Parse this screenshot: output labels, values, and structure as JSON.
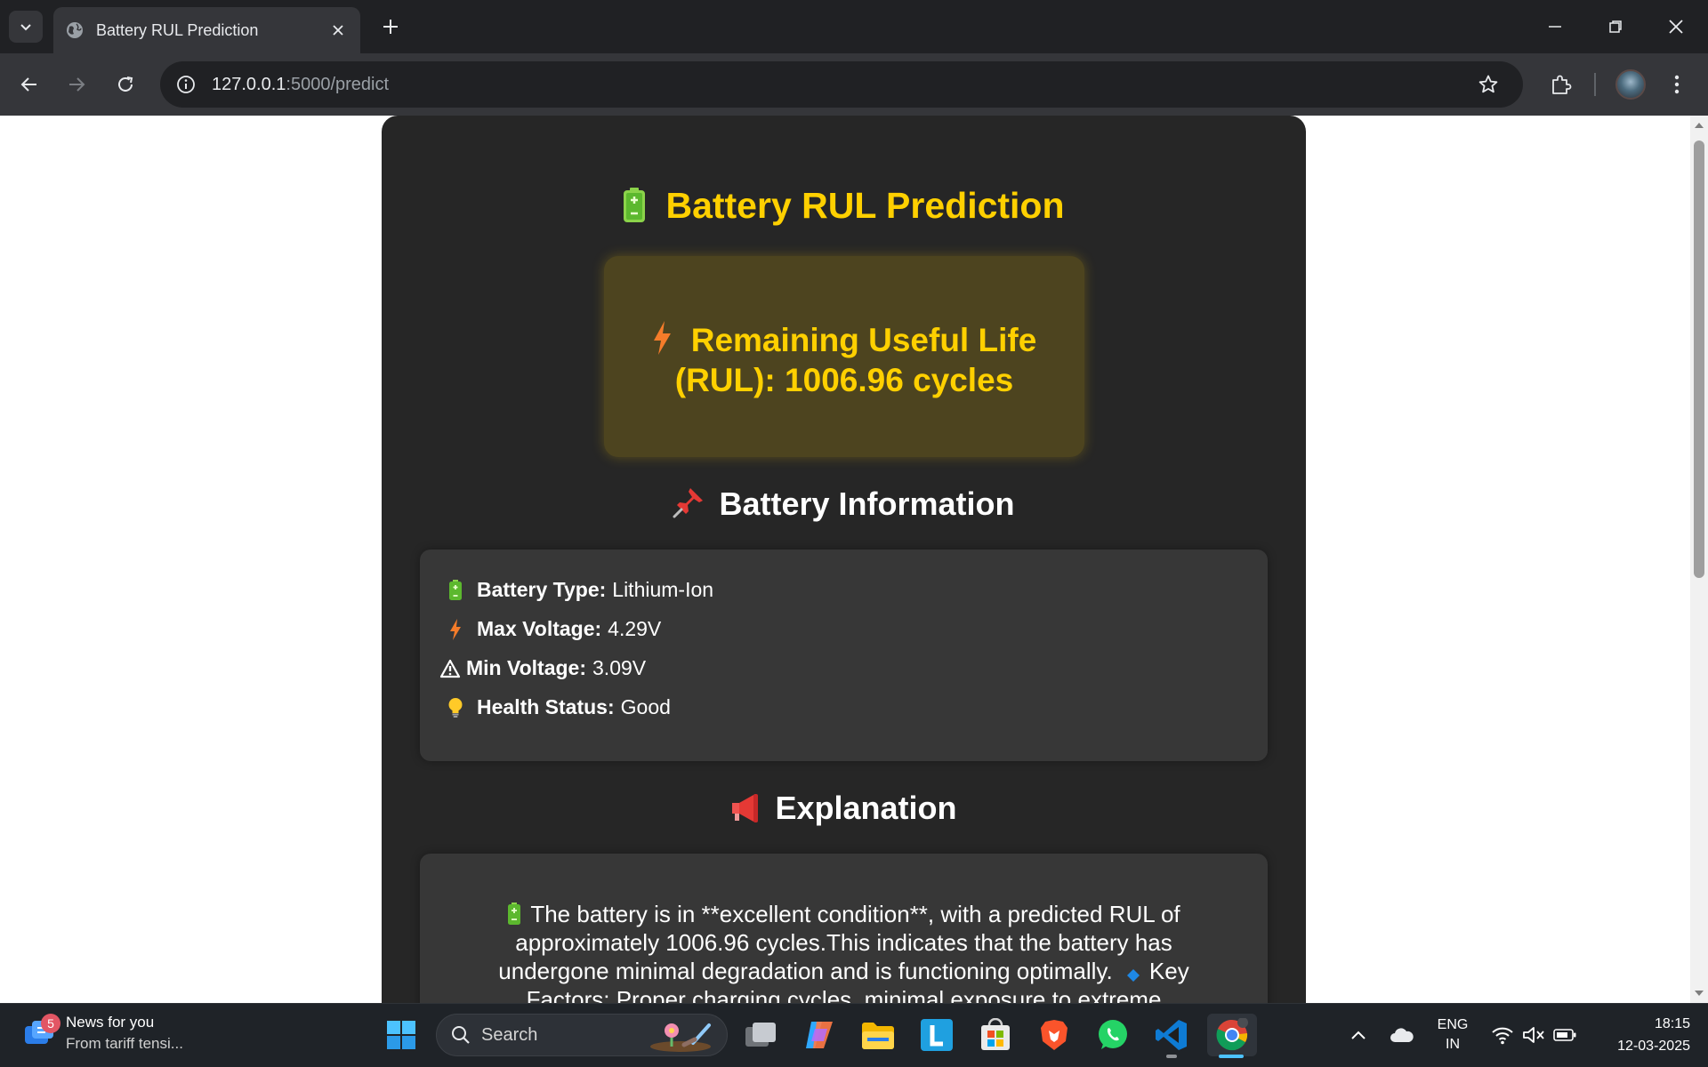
{
  "browser": {
    "tab_title": "Battery RUL Prediction",
    "url_host": "127.0.0.1",
    "url_path": ":5000/predict"
  },
  "page": {
    "title": "Battery RUL Prediction",
    "rul_label": "Remaining Useful Life (RUL):",
    "rul_value": "1006.96 cycles",
    "info_title": "Battery Information",
    "info_items": [
      {
        "icon": "battery-icon",
        "label": "Battery Type:",
        "value": "Lithium-Ion"
      },
      {
        "icon": "lightning-icon",
        "label": "Max Voltage:",
        "value": "4.29V"
      },
      {
        "icon": "warning-icon",
        "label": "Min Voltage:",
        "value": "3.09V"
      },
      {
        "icon": "lightbulb-icon",
        "label": "Health Status:",
        "value": "Good"
      }
    ],
    "explanation_title": "Explanation",
    "explanation_text": "The battery is in **excellent condition**, with a predicted RUL of approximately 1006.96 cycles.This indicates that the battery has undergone minimal degradation and is functioning optimally.",
    "explanation_text_2": "Key Factors: Proper charging cycles, minimal exposure to extreme"
  },
  "taskbar": {
    "news_badge": "5",
    "news_title": "News for you",
    "news_subtitle": "From tariff tensi...",
    "search_label": "Search",
    "lang_line1": "ENG",
    "lang_line2": "IN",
    "time": "18:15",
    "date": "12-03-2025"
  },
  "colors": {
    "accent_yellow": "#ffd000",
    "card_bg": "#262626",
    "panel_bg": "#373737",
    "rul_bg": "#4d441f"
  }
}
